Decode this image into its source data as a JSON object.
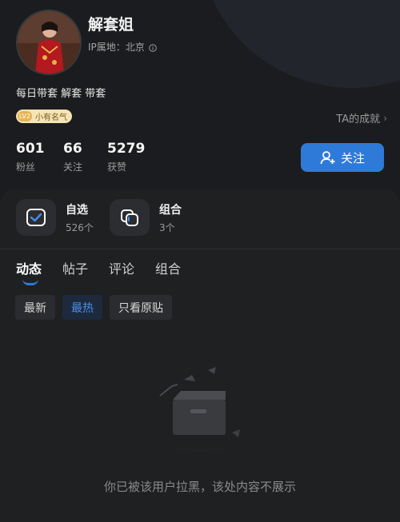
{
  "profile": {
    "username": "解套姐",
    "ip_location": "IP属地：北京",
    "bio": "每日带套 解套 带套",
    "badge_level": "LV2",
    "badge_label": "小有名气",
    "achievements_link": "TA的成就"
  },
  "stats": [
    {
      "value": "601",
      "label": "粉丝"
    },
    {
      "value": "66",
      "label": "关注"
    },
    {
      "value": "5279",
      "label": "获赞"
    }
  ],
  "follow_button": {
    "label": "关注"
  },
  "quick_cards": [
    {
      "title": "自选",
      "count": "526个"
    },
    {
      "title": "组合",
      "count": "3个"
    }
  ],
  "tabs": [
    "动态",
    "帖子",
    "评论",
    "组合"
  ],
  "active_tab": "动态",
  "filters": [
    "最新",
    "最热",
    "只看原贴"
  ],
  "active_filter": "最热",
  "empty_state": {
    "message": "你已被该用户拉黑，该处内容不展示"
  },
  "colors": {
    "accent": "#2e7ad8",
    "background": "#1c1c1e",
    "badge_bg": "#f4e4b6"
  },
  "icons": [
    "info-icon",
    "chevron-right-icon",
    "add-user-icon",
    "watchlist-check-icon",
    "portfolio-icon",
    "empty-box-icon"
  ]
}
